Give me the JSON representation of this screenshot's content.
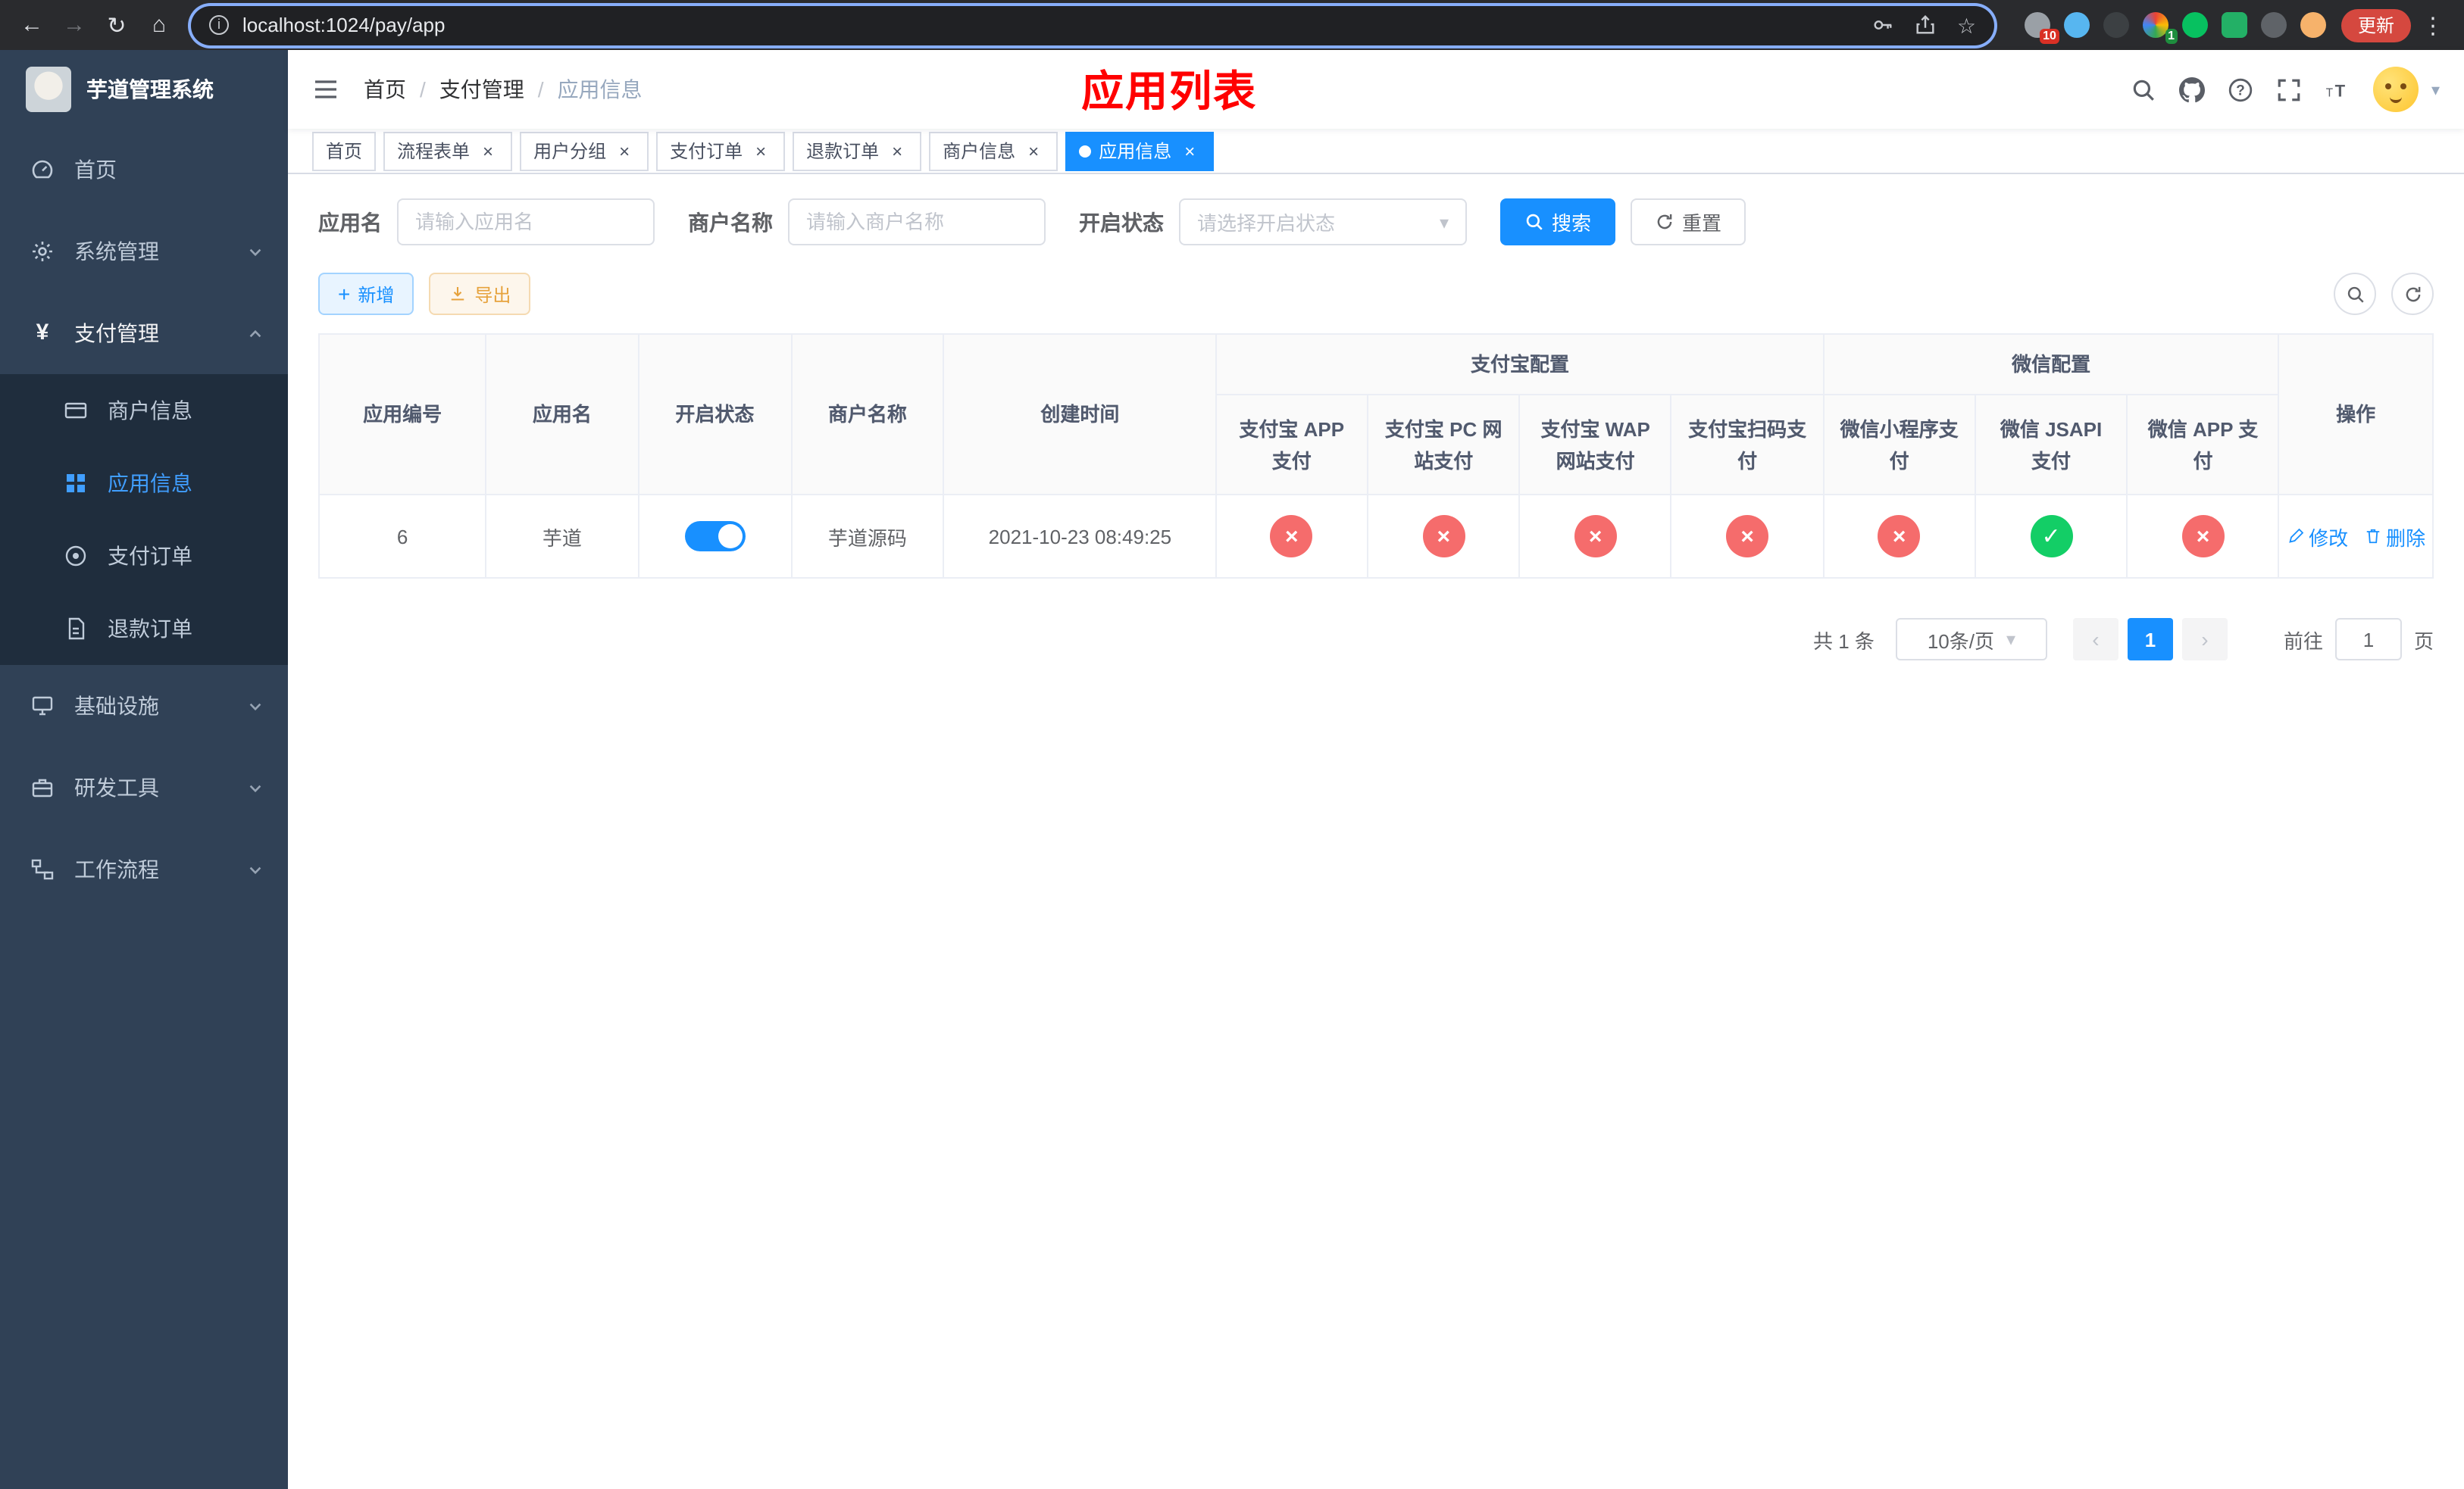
{
  "colors": {
    "accent": "#1890ff",
    "success": "#13ce66",
    "danger": "#f56c6c",
    "warning": "#e6a23c",
    "title_red": "#ff0000",
    "sidebar_bg": "#304156",
    "submenu_bg": "#1f2d3d"
  },
  "icons": {
    "back": "←",
    "forward": "→",
    "reload": "↻",
    "home": "⌂",
    "star": "☆",
    "menu_dots": "⋮",
    "info": "i",
    "close": "×",
    "caret_down": "▾",
    "plus": "+",
    "yen": "¥",
    "prev": "‹",
    "next": "›",
    "check": "✓",
    "cross": "×"
  },
  "browser": {
    "url": "localhost:1024/pay/app",
    "update_label": "更新",
    "extension_badge_red": "10",
    "extension_badge_green": "1"
  },
  "sidebar": {
    "title": "芋道管理系统",
    "items": [
      {
        "label": "首页"
      },
      {
        "label": "系统管理"
      },
      {
        "label": "支付管理",
        "children": [
          {
            "label": "商户信息"
          },
          {
            "label": "应用信息"
          },
          {
            "label": "支付订单"
          },
          {
            "label": "退款订单"
          }
        ]
      },
      {
        "label": "基础设施"
      },
      {
        "label": "研发工具"
      },
      {
        "label": "工作流程"
      }
    ]
  },
  "header": {
    "breadcrumb": [
      "首页",
      "支付管理",
      "应用信息"
    ],
    "page_title": "应用列表"
  },
  "tabs": [
    {
      "label": "首页"
    },
    {
      "label": "流程表单"
    },
    {
      "label": "用户分组"
    },
    {
      "label": "支付订单"
    },
    {
      "label": "退款订单"
    },
    {
      "label": "商户信息"
    },
    {
      "label": "应用信息"
    }
  ],
  "filters": {
    "app_name_label": "应用名",
    "app_name_placeholder": "请输入应用名",
    "merchant_label": "商户名称",
    "merchant_placeholder": "请输入商户名称",
    "status_label": "开启状态",
    "status_placeholder": "请选择开启状态",
    "search_label": "搜索",
    "reset_label": "重置"
  },
  "toolbar": {
    "add_label": "新增",
    "export_label": "导出"
  },
  "table": {
    "group_alipay": "支付宝配置",
    "group_wechat": "微信配置",
    "columns": [
      "应用编号",
      "应用名",
      "开启状态",
      "商户名称",
      "创建时间",
      "支付宝 APP 支付",
      "支付宝 PC 网站支付",
      "支付宝 WAP 网站支付",
      "支付宝扫码支付",
      "微信小程序支付",
      "微信 JSAPI 支付",
      "微信 APP 支付",
      "操作"
    ],
    "rows": [
      {
        "id": "6",
        "app_name": "芋道",
        "status_on": true,
        "merchant_name": "芋道源码",
        "create_time": "2021-10-23 08:49:25",
        "configs": [
          false,
          false,
          false,
          false,
          false,
          true,
          false
        ],
        "edit_label": "修改",
        "delete_label": "删除"
      }
    ]
  },
  "pagination": {
    "total_label": "共 1 条",
    "page_size_label": "10条/页",
    "current_page": "1",
    "goto_label": "前往",
    "goto_value": "1",
    "page_suffix": "页"
  }
}
